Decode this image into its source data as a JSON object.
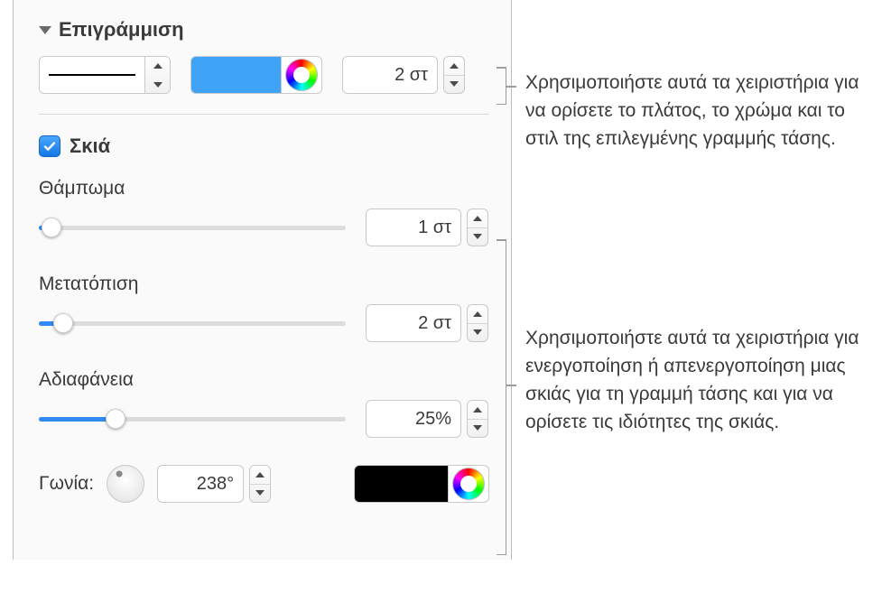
{
  "stroke": {
    "section_label": "Επιγράμμιση",
    "color": "#3fa4f6",
    "width_value": "2 στ"
  },
  "shadow": {
    "checkbox_label": "Σκιά",
    "checked": true,
    "blur_label": "Θάμπωμα",
    "blur_value": "1 στ",
    "blur_percent": 4,
    "offset_label": "Μετατόπιση",
    "offset_value": "2 στ",
    "offset_percent": 8,
    "opacity_label": "Αδιαφάνεια",
    "opacity_value": "25%",
    "opacity_percent": 25,
    "angle_label": "Γωνία:",
    "angle_value": "238°",
    "angle_degrees": 238,
    "color": "#000000"
  },
  "callouts": {
    "stroke_text": "Χρησιμοποιήστε αυτά τα χειριστήρια για να ορίσετε το πλάτος, το χρώμα και το στιλ της επιλεγμένης γραμμής τάσης.",
    "shadow_text": "Χρησιμοποιήστε αυτά τα χειριστήρια για ενεργοποίηση ή απενεργοποίηση μιας σκιάς για τη γραμμή τάσης και για να ορίσετε τις ιδιότητες της σκιάς."
  }
}
